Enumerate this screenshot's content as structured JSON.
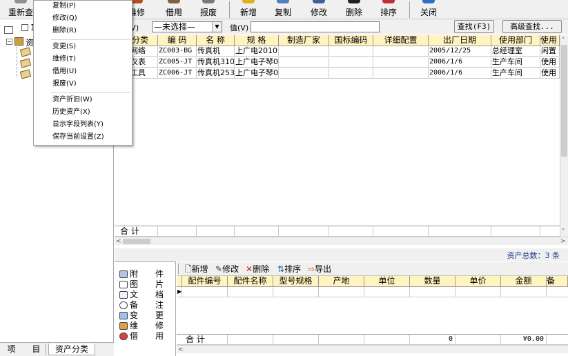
{
  "toolbar": {
    "buttons": [
      {
        "label": "重新查",
        "icon": "refresh-icon"
      },
      {
        "label": "维修",
        "icon": "repair-icon"
      },
      {
        "label": "借用",
        "icon": "borrow-icon"
      },
      {
        "label": "报废",
        "icon": "scrap-icon"
      },
      {
        "label": "新增",
        "icon": "add-icon"
      },
      {
        "label": "复制",
        "icon": "copy-icon"
      },
      {
        "label": "修改",
        "icon": "edit-icon"
      },
      {
        "label": "删除",
        "icon": "delete-icon"
      },
      {
        "label": "排序",
        "icon": "sort-icon"
      },
      {
        "label": "关闭",
        "icon": "close-icon"
      }
    ],
    "colors": {
      "repair": "#b05020",
      "borrow": "#806040",
      "scrap": "#7a7a7a",
      "add": "#e0b020",
      "copy": "#5080c0",
      "edit": "#4060a0",
      "delete": "#202020",
      "sort": "#c03030",
      "close": "#3070c0",
      "refresh": "#909090"
    }
  },
  "context_menu": {
    "items": [
      "复制(P)",
      "修改(Q)",
      "删除(R)",
      "变更(S)",
      "维修(T)",
      "借用(U)",
      "报废(V)",
      "资产折旧(W)",
      "历史资产(X)",
      "显示字段列表(Y)",
      "保存当前设置(Z)"
    ]
  },
  "tree": {
    "checkbox_label": "1",
    "root_label": "资"
  },
  "search": {
    "field_label": "家(V)",
    "field_value": "—未选择—",
    "value_label": "值(V)",
    "value_text": "",
    "find_button": "查找(F3)",
    "advanced_button": "高级查找..."
  },
  "main_grid": {
    "columns": [
      "产分类",
      "编 码",
      "名 称",
      "规 格",
      "制造厂家",
      "国标编码",
      "详细配置",
      "出厂日期",
      "使用部门",
      "使用"
    ],
    "rows": [
      [
        "电脑网络",
        "ZC003-BG",
        "传真机",
        "上广电2010",
        "",
        "",
        "",
        "2005/12/25",
        "总经理室",
        "闲置"
      ],
      [
        "仪器仪表",
        "ZC005-JT",
        "传真机310",
        "上广电子琴0",
        "",
        "",
        "",
        "2006/1/6",
        "生产车间",
        "使用"
      ],
      [
        "交通工具",
        "ZC006-JT",
        "传真机253",
        "上广电子琴0",
        "",
        "",
        "",
        "2006/1/6",
        "生产车间",
        "使用"
      ]
    ],
    "total_label": "合 计",
    "asset_count": "资产总数：3 条"
  },
  "bottom_panel": {
    "side_items": [
      {
        "c1": "附",
        "c2": "件",
        "icon": "attachment-icon"
      },
      {
        "c1": "图",
        "c2": "片",
        "icon": "picture-icon"
      },
      {
        "c1": "文",
        "c2": "档",
        "icon": "document-icon"
      },
      {
        "c1": "备",
        "c2": "注",
        "icon": "note-icon"
      },
      {
        "c1": "变",
        "c2": "更",
        "icon": "change-icon"
      },
      {
        "c1": "维",
        "c2": "修",
        "icon": "repair-icon"
      },
      {
        "c1": "借",
        "c2": "用",
        "icon": "borrow-icon"
      }
    ],
    "sub_toolbar": [
      "新增",
      "修改",
      "删除",
      "排序",
      "导出"
    ],
    "columns": [
      "配件编号",
      "配件名称",
      "型号规格",
      "产地",
      "单位",
      "数量",
      "单价",
      "金额",
      "备"
    ],
    "total_label": "合 计",
    "total_qty": "0",
    "total_amount": "¥0.00"
  },
  "left_tabs": [
    "项　　目",
    "资产分类"
  ]
}
